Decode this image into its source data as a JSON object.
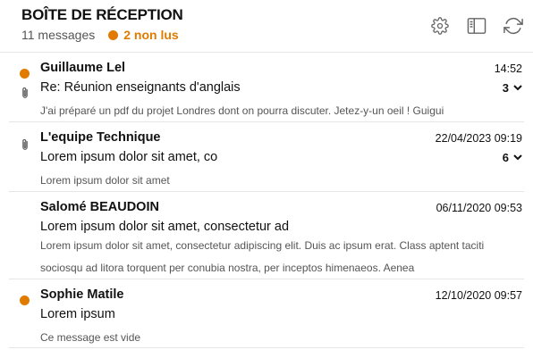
{
  "header": {
    "title": "BOÎTE DE RÉCEPTION",
    "message_count": "11 messages",
    "unread_count": "2 non lus",
    "accent_color": "#e07b00",
    "icons": [
      "gear-icon",
      "sidebar-panel-icon",
      "refresh-icon"
    ]
  },
  "messages": [
    {
      "sender": "Guillaume Lel",
      "date": "14:52",
      "subject": "Re: Réunion enseignants d'anglais",
      "preview": "J'ai préparé un pdf du projet Londres dont on pourra discuter. Jetez-y-un oeil ! Guigui",
      "thread_count": "3",
      "unread": true,
      "attachment": true
    },
    {
      "sender": "L'equipe Technique",
      "date": "22/04/2023 09:19",
      "subject": "Lorem ipsum dolor sit amet, co",
      "preview": "Lorem ipsum dolor sit amet",
      "thread_count": "6",
      "unread": false,
      "attachment": true
    },
    {
      "sender": "Salomé BEAUDOIN",
      "date": "06/11/2020 09:53",
      "subject": "Lorem ipsum dolor sit amet, consectetur ad",
      "preview": "Lorem ipsum dolor sit amet, consectetur adipiscing elit. Duis ac ipsum erat. Class aptent taciti sociosqu ad litora torquent per conubia nostra, per inceptos himenaeos. Aenea",
      "thread_count": "",
      "unread": false,
      "attachment": false
    },
    {
      "sender": "Sophie Matile",
      "date": "12/10/2020 09:57",
      "subject": "Lorem ipsum",
      "preview": "Ce message est vide",
      "thread_count": "",
      "unread": true,
      "attachment": false
    }
  ]
}
